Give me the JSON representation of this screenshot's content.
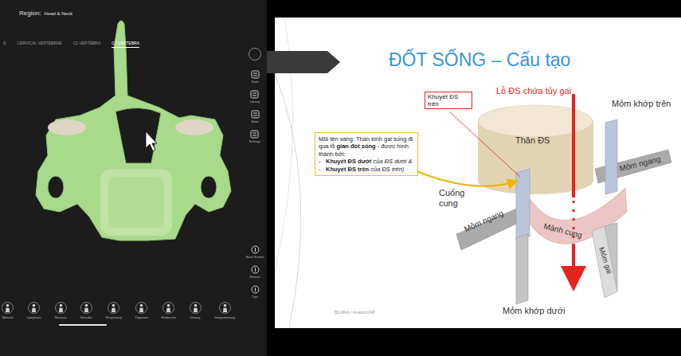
{
  "viewer": {
    "region_label": "Region:",
    "region": "Head & Neck",
    "tabs": [
      {
        "label": "S",
        "selected": false
      },
      {
        "label": "CERVICAL VERTEBRAE",
        "selected": false
      },
      {
        "label": "C1 VERTEBRA",
        "selected": false
      },
      {
        "label": "C7 VERTEBRA",
        "selected": true
      }
    ],
    "side_tools": [
      "Tools",
      "Library",
      "Store",
      "Settings",
      "Save Screen",
      "Version",
      "Tips"
    ],
    "systems": [
      "Skeletal",
      "Lymphatic",
      "Nervous",
      "Vascular",
      "Respiratory",
      "Digestive",
      "Endocrine",
      "Urinary",
      "Integumentary"
    ],
    "scrollbar": {
      "start": 0.22,
      "level": 0.18
    }
  },
  "slide": {
    "title": "ĐỐT SỐNG – Cấu tạo",
    "labels": [
      {
        "text": "Khuyết ĐS trên",
        "kind": "boxed"
      },
      {
        "text": "Lỗ ĐS chứa tủy gai",
        "kind": "red"
      },
      {
        "text": "Mỏm khớp trên",
        "kind": "plain"
      },
      {
        "text": "Thân ĐS",
        "kind": "plain"
      },
      {
        "text": "Mỏm ngang",
        "kind": "plain"
      },
      {
        "text": "Cuống cung",
        "kind": "plain"
      },
      {
        "text": "Mỏm ngang",
        "kind": "plain"
      },
      {
        "text": "Mảnh cung",
        "kind": "plain"
      },
      {
        "text": "Mỏm gai",
        "kind": "plain"
      },
      {
        "text": "Mỏm khớp dưới",
        "kind": "plain"
      }
    ],
    "callout": {
      "intro": "Mũi tên vàng: Thần kinh gai sống đi qua lỗ ",
      "intro_bold": "gian đốt sống",
      "intro_end": " - được hình thành bởi:",
      "items": [
        {
          "bullet": "-",
          "bold": "Khuyết ĐS dưới",
          "rest": " của ĐS dưới &"
        },
        {
          "bullet": "-",
          "bold": "Khuyết ĐS trên",
          "rest": " của ĐS trên)"
        }
      ]
    },
    "footer": "BS Minh / AnatomUMP"
  }
}
